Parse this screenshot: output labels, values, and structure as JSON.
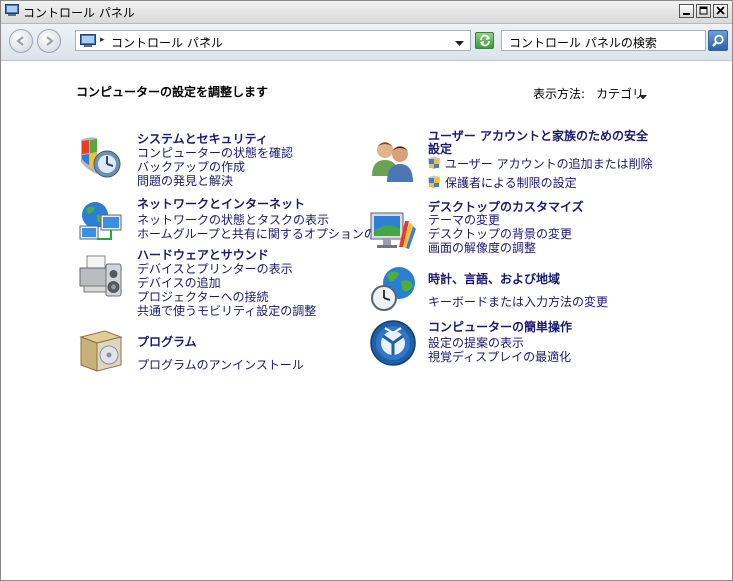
{
  "window": {
    "title": "コントロール パネル"
  },
  "address_bar": {
    "breadcrumb": "コントロール パネル",
    "search_placeholder": "コントロール パネルの検索"
  },
  "content": {
    "heading": "コンピューターの設定を調整します",
    "view_by_label": "表示方法:",
    "view_by_value": "カテゴリ"
  },
  "categories": [
    {
      "title": "システムとセキュリティ",
      "icon": "shield-security-icon",
      "links": [
        "コンピューターの状態を確認",
        "バックアップの作成",
        "問題の発見と解決"
      ]
    },
    {
      "title": "ネットワークとインターネット",
      "icon": "network-globe-icon",
      "links": [
        "ネットワークの状態とタスクの表示",
        "ホームグループと共有に関するオプションの選択"
      ]
    },
    {
      "title": "ハードウェアとサウンド",
      "icon": "printer-speaker-icon",
      "links": [
        "デバイスとプリンターの表示",
        "デバイスの追加",
        "プロジェクターへの接続",
        "共通で使うモビリティ設定の調整"
      ]
    },
    {
      "title": "プログラム",
      "icon": "programs-box-icon",
      "links": [
        "プログラムのアンインストール"
      ]
    },
    {
      "title": "ユーザー アカウントと家族のための安全設定",
      "icon": "users-icon",
      "links": [
        "ユーザー アカウントの追加または削除",
        "保護者による制限の設定"
      ]
    },
    {
      "title": "デスクトップのカスタマイズ",
      "icon": "monitor-palette-icon",
      "links": [
        "テーマの変更",
        "デスクトップの背景の変更",
        "画面の解像度の調整"
      ]
    },
    {
      "title": "時計、言語、および地域",
      "icon": "globe-clock-icon",
      "links": [
        "キーボードまたは入力方法の変更"
      ]
    },
    {
      "title": "コンピューターの簡単操作",
      "icon": "ease-of-access-icon",
      "links": [
        "設定の提案の表示",
        "視覚ディスプレイの最適化"
      ]
    }
  ]
}
